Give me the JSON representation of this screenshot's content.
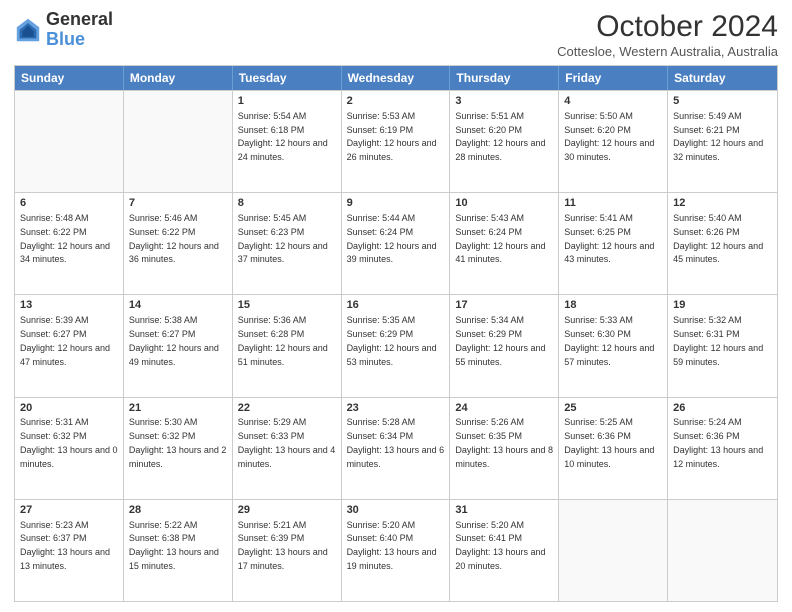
{
  "header": {
    "logo_general": "General",
    "logo_blue": "Blue",
    "month_title": "October 2024",
    "location": "Cottesloe, Western Australia, Australia"
  },
  "days_of_week": [
    "Sunday",
    "Monday",
    "Tuesday",
    "Wednesday",
    "Thursday",
    "Friday",
    "Saturday"
  ],
  "weeks": [
    [
      {
        "day": "",
        "empty": true
      },
      {
        "day": "",
        "empty": true
      },
      {
        "day": "1",
        "sunrise": "Sunrise: 5:54 AM",
        "sunset": "Sunset: 6:18 PM",
        "daylight": "Daylight: 12 hours and 24 minutes."
      },
      {
        "day": "2",
        "sunrise": "Sunrise: 5:53 AM",
        "sunset": "Sunset: 6:19 PM",
        "daylight": "Daylight: 12 hours and 26 minutes."
      },
      {
        "day": "3",
        "sunrise": "Sunrise: 5:51 AM",
        "sunset": "Sunset: 6:20 PM",
        "daylight": "Daylight: 12 hours and 28 minutes."
      },
      {
        "day": "4",
        "sunrise": "Sunrise: 5:50 AM",
        "sunset": "Sunset: 6:20 PM",
        "daylight": "Daylight: 12 hours and 30 minutes."
      },
      {
        "day": "5",
        "sunrise": "Sunrise: 5:49 AM",
        "sunset": "Sunset: 6:21 PM",
        "daylight": "Daylight: 12 hours and 32 minutes."
      }
    ],
    [
      {
        "day": "6",
        "sunrise": "Sunrise: 5:48 AM",
        "sunset": "Sunset: 6:22 PM",
        "daylight": "Daylight: 12 hours and 34 minutes."
      },
      {
        "day": "7",
        "sunrise": "Sunrise: 5:46 AM",
        "sunset": "Sunset: 6:22 PM",
        "daylight": "Daylight: 12 hours and 36 minutes."
      },
      {
        "day": "8",
        "sunrise": "Sunrise: 5:45 AM",
        "sunset": "Sunset: 6:23 PM",
        "daylight": "Daylight: 12 hours and 37 minutes."
      },
      {
        "day": "9",
        "sunrise": "Sunrise: 5:44 AM",
        "sunset": "Sunset: 6:24 PM",
        "daylight": "Daylight: 12 hours and 39 minutes."
      },
      {
        "day": "10",
        "sunrise": "Sunrise: 5:43 AM",
        "sunset": "Sunset: 6:24 PM",
        "daylight": "Daylight: 12 hours and 41 minutes."
      },
      {
        "day": "11",
        "sunrise": "Sunrise: 5:41 AM",
        "sunset": "Sunset: 6:25 PM",
        "daylight": "Daylight: 12 hours and 43 minutes."
      },
      {
        "day": "12",
        "sunrise": "Sunrise: 5:40 AM",
        "sunset": "Sunset: 6:26 PM",
        "daylight": "Daylight: 12 hours and 45 minutes."
      }
    ],
    [
      {
        "day": "13",
        "sunrise": "Sunrise: 5:39 AM",
        "sunset": "Sunset: 6:27 PM",
        "daylight": "Daylight: 12 hours and 47 minutes."
      },
      {
        "day": "14",
        "sunrise": "Sunrise: 5:38 AM",
        "sunset": "Sunset: 6:27 PM",
        "daylight": "Daylight: 12 hours and 49 minutes."
      },
      {
        "day": "15",
        "sunrise": "Sunrise: 5:36 AM",
        "sunset": "Sunset: 6:28 PM",
        "daylight": "Daylight: 12 hours and 51 minutes."
      },
      {
        "day": "16",
        "sunrise": "Sunrise: 5:35 AM",
        "sunset": "Sunset: 6:29 PM",
        "daylight": "Daylight: 12 hours and 53 minutes."
      },
      {
        "day": "17",
        "sunrise": "Sunrise: 5:34 AM",
        "sunset": "Sunset: 6:29 PM",
        "daylight": "Daylight: 12 hours and 55 minutes."
      },
      {
        "day": "18",
        "sunrise": "Sunrise: 5:33 AM",
        "sunset": "Sunset: 6:30 PM",
        "daylight": "Daylight: 12 hours and 57 minutes."
      },
      {
        "day": "19",
        "sunrise": "Sunrise: 5:32 AM",
        "sunset": "Sunset: 6:31 PM",
        "daylight": "Daylight: 12 hours and 59 minutes."
      }
    ],
    [
      {
        "day": "20",
        "sunrise": "Sunrise: 5:31 AM",
        "sunset": "Sunset: 6:32 PM",
        "daylight": "Daylight: 13 hours and 0 minutes."
      },
      {
        "day": "21",
        "sunrise": "Sunrise: 5:30 AM",
        "sunset": "Sunset: 6:32 PM",
        "daylight": "Daylight: 13 hours and 2 minutes."
      },
      {
        "day": "22",
        "sunrise": "Sunrise: 5:29 AM",
        "sunset": "Sunset: 6:33 PM",
        "daylight": "Daylight: 13 hours and 4 minutes."
      },
      {
        "day": "23",
        "sunrise": "Sunrise: 5:28 AM",
        "sunset": "Sunset: 6:34 PM",
        "daylight": "Daylight: 13 hours and 6 minutes."
      },
      {
        "day": "24",
        "sunrise": "Sunrise: 5:26 AM",
        "sunset": "Sunset: 6:35 PM",
        "daylight": "Daylight: 13 hours and 8 minutes."
      },
      {
        "day": "25",
        "sunrise": "Sunrise: 5:25 AM",
        "sunset": "Sunset: 6:36 PM",
        "daylight": "Daylight: 13 hours and 10 minutes."
      },
      {
        "day": "26",
        "sunrise": "Sunrise: 5:24 AM",
        "sunset": "Sunset: 6:36 PM",
        "daylight": "Daylight: 13 hours and 12 minutes."
      }
    ],
    [
      {
        "day": "27",
        "sunrise": "Sunrise: 5:23 AM",
        "sunset": "Sunset: 6:37 PM",
        "daylight": "Daylight: 13 hours and 13 minutes."
      },
      {
        "day": "28",
        "sunrise": "Sunrise: 5:22 AM",
        "sunset": "Sunset: 6:38 PM",
        "daylight": "Daylight: 13 hours and 15 minutes."
      },
      {
        "day": "29",
        "sunrise": "Sunrise: 5:21 AM",
        "sunset": "Sunset: 6:39 PM",
        "daylight": "Daylight: 13 hours and 17 minutes."
      },
      {
        "day": "30",
        "sunrise": "Sunrise: 5:20 AM",
        "sunset": "Sunset: 6:40 PM",
        "daylight": "Daylight: 13 hours and 19 minutes."
      },
      {
        "day": "31",
        "sunrise": "Sunrise: 5:20 AM",
        "sunset": "Sunset: 6:41 PM",
        "daylight": "Daylight: 13 hours and 20 minutes."
      },
      {
        "day": "",
        "empty": true
      },
      {
        "day": "",
        "empty": true
      }
    ]
  ]
}
